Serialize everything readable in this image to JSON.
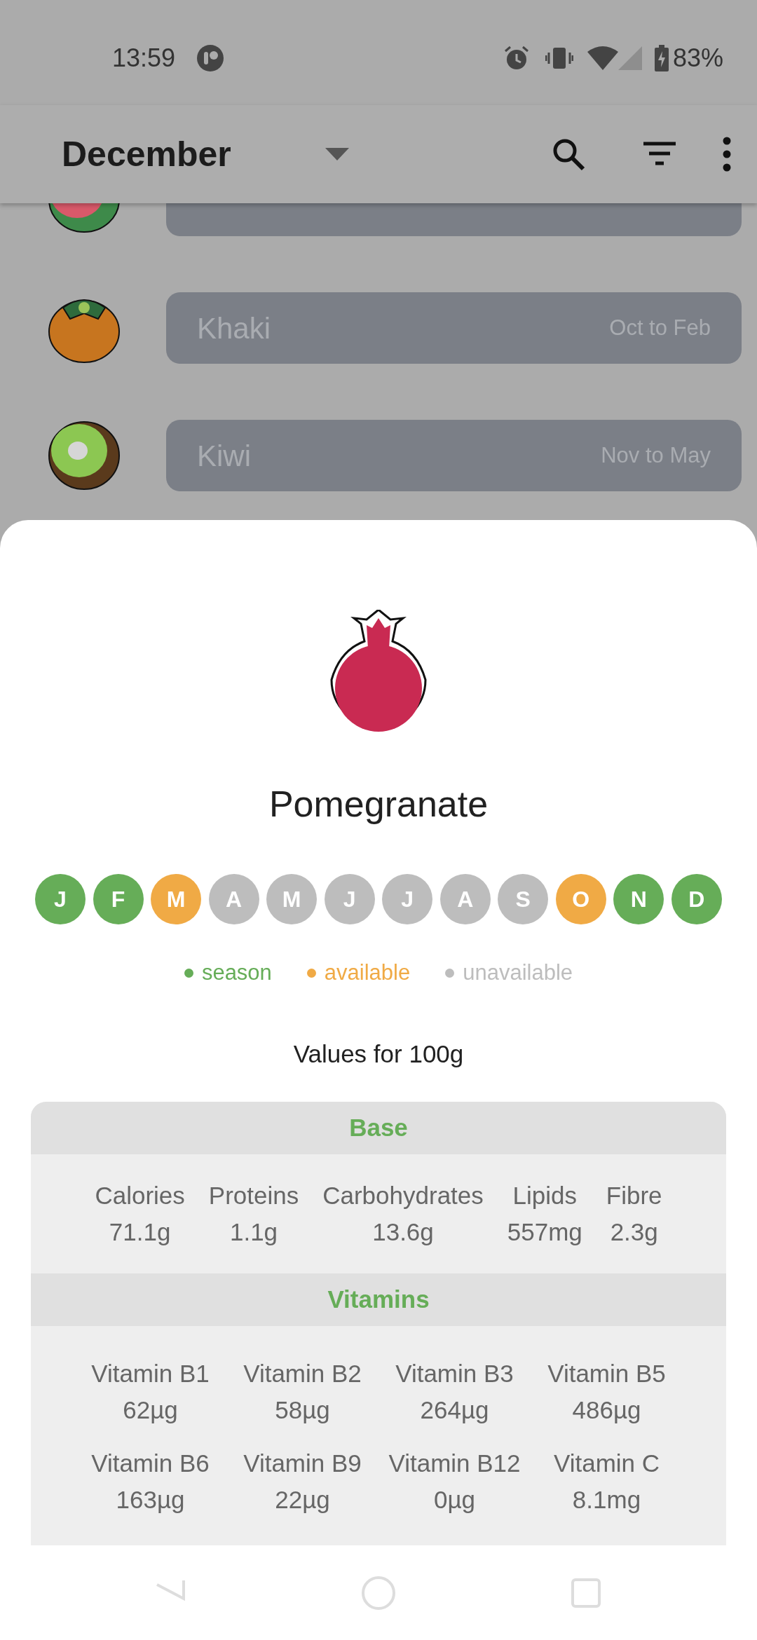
{
  "status_bar": {
    "time": "13:59",
    "battery": "83%"
  },
  "app_bar": {
    "title": "December"
  },
  "fruit_list": [
    {
      "kind": "partial"
    },
    {
      "kind": "full",
      "name": "Khaki",
      "season": "Oct to Feb"
    },
    {
      "kind": "full",
      "name": "Kiwi",
      "season": "Nov to May"
    }
  ],
  "detail": {
    "name": "Pomegranate",
    "months": [
      {
        "letter": "J",
        "color": "#66ad58"
      },
      {
        "letter": "F",
        "color": "#66ad58"
      },
      {
        "letter": "M",
        "color": "#f0aa45"
      },
      {
        "letter": "A",
        "color": "#bdbdbd"
      },
      {
        "letter": "M",
        "color": "#bdbdbd"
      },
      {
        "letter": "J",
        "color": "#bdbdbd"
      },
      {
        "letter": "J",
        "color": "#bdbdbd"
      },
      {
        "letter": "A",
        "color": "#bdbdbd"
      },
      {
        "letter": "S",
        "color": "#bdbdbd"
      },
      {
        "letter": "O",
        "color": "#f0aa45"
      },
      {
        "letter": "N",
        "color": "#66ad58"
      },
      {
        "letter": "D",
        "color": "#66ad58"
      }
    ],
    "legend": [
      {
        "label": "season",
        "color": "#66ad58"
      },
      {
        "label": "available",
        "color": "#f0aa45"
      },
      {
        "label": "unavailable",
        "color": "#bdbdbd"
      }
    ],
    "values_title": "Values for 100g",
    "sections": [
      {
        "title": "Base",
        "kind": "row",
        "items": [
          {
            "label": "Calories",
            "value": "71.1g"
          },
          {
            "label": "Proteins",
            "value": "1.1g"
          },
          {
            "label": "Carbohydrates",
            "value": "13.6g"
          },
          {
            "label": "Lipids",
            "value": "557mg"
          },
          {
            "label": "Fibre",
            "value": "2.3g"
          }
        ]
      },
      {
        "title": "Vitamins",
        "kind": "grid",
        "items": [
          {
            "label": "Vitamin B1",
            "value": "62µg"
          },
          {
            "label": "Vitamin B2",
            "value": "58µg"
          },
          {
            "label": "Vitamin B3",
            "value": "264µg"
          },
          {
            "label": "Vitamin B5",
            "value": "486µg"
          },
          {
            "label": "Vitamin B6",
            "value": "163µg"
          },
          {
            "label": "Vitamin B9",
            "value": "22µg"
          },
          {
            "label": "Vitamin B12",
            "value": "0µg"
          },
          {
            "label": "Vitamin C",
            "value": "8.1mg"
          }
        ]
      }
    ]
  }
}
